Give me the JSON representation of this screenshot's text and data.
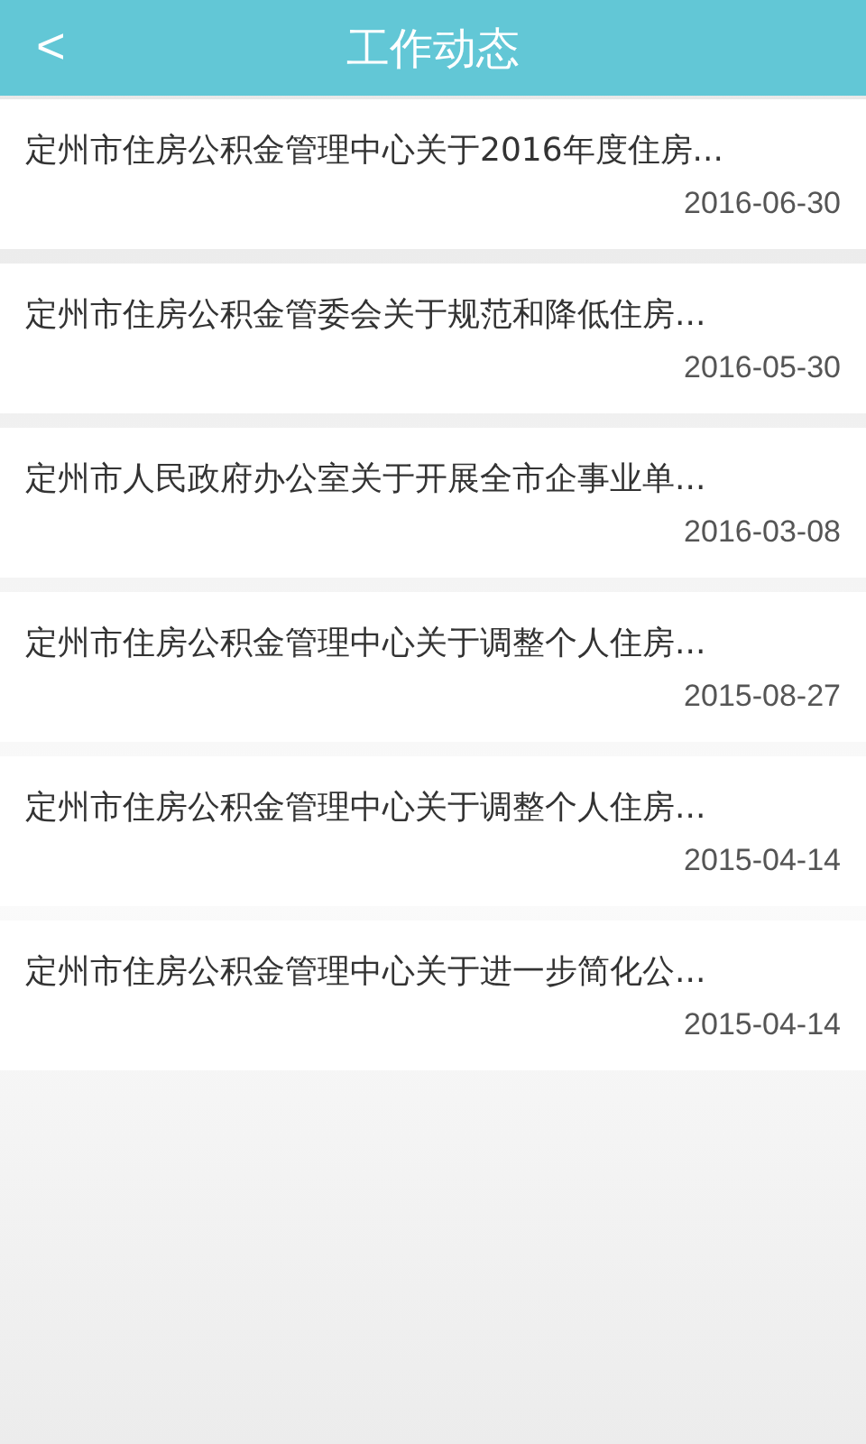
{
  "header": {
    "back": "<",
    "title": "工作动态"
  },
  "items": [
    {
      "title": "定州市住房公积金管理中心关于2016年度住房...",
      "date": "2016-06-30"
    },
    {
      "title": "定州市住房公积金管委会关于规范和降低住房...",
      "date": "2016-05-30"
    },
    {
      "title": "定州市人民政府办公室关于开展全市企事业单...",
      "date": "2016-03-08"
    },
    {
      "title": "定州市住房公积金管理中心关于调整个人住房...",
      "date": "2015-08-27"
    },
    {
      "title": "定州市住房公积金管理中心关于调整个人住房...",
      "date": "2015-04-14"
    },
    {
      "title": "定州市住房公积金管理中心关于进一步简化公...",
      "date": "2015-04-14"
    }
  ]
}
